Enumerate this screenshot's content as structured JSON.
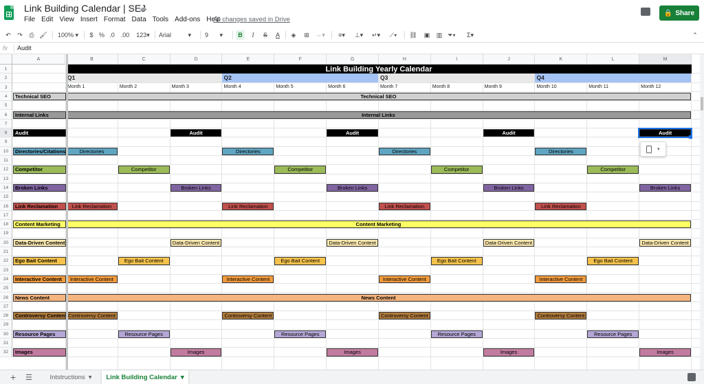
{
  "app": {
    "title": "Link Building Calendar | SEJ",
    "menu": [
      "File",
      "Edit",
      "View",
      "Insert",
      "Format",
      "Data",
      "Tools",
      "Add-ons",
      "Help"
    ],
    "saved_status": "All changes saved in Drive",
    "share_label": "Share"
  },
  "toolbar": {
    "zoom": "100%",
    "currency": "$",
    "percent": "%",
    "decimal_dec": ".0",
    "decimal_inc": ".00",
    "number_format": "123",
    "font": "Arial",
    "font_size": "9",
    "bold": "B",
    "italic": "I",
    "strike": "S",
    "text_color": "A"
  },
  "formula_bar": {
    "fx": "fx",
    "value": "Audit"
  },
  "grid": {
    "columns": [
      "A",
      "B",
      "C",
      "D",
      "E",
      "F",
      "G",
      "H",
      "I",
      "J",
      "K",
      "L",
      "M"
    ],
    "rows": [
      "1",
      "2",
      "3",
      "4",
      "5",
      "6",
      "7",
      "8",
      "9",
      "10",
      "11",
      "12",
      "13",
      "14",
      "15",
      "16",
      "17",
      "18",
      "19",
      "20",
      "21",
      "22",
      "23",
      "24",
      "25",
      "26",
      "27",
      "28",
      "29",
      "30",
      "31",
      "32"
    ],
    "selected_column": "M",
    "selected_row": "8",
    "title": "Link Building Yearly Calendar",
    "quarters": [
      "Q1",
      "Q2",
      "Q3",
      "Q4"
    ],
    "months": [
      "Month 1",
      "Month 2",
      "Month 3",
      "Month 4",
      "Month 5",
      "Month 6",
      "Month 7",
      "Month 8",
      "Month 9",
      "Month 10",
      "Month 11",
      "Month 12"
    ],
    "categories": [
      {
        "row": 4,
        "label": "Technical SEO",
        "color": "#d0d0d0",
        "text_color": "#000000",
        "span": true,
        "span_text": "Technical SEO"
      },
      {
        "row": 6,
        "label": "Internal Links",
        "color": "#999999",
        "text_color": "#000000",
        "span": true,
        "span_text": "Internal Links"
      },
      {
        "row": 8,
        "label": "Audit",
        "color": "#000000",
        "text_color": "#ffffff",
        "bars": [
          {
            "col": 3,
            "text": "Audit"
          },
          {
            "col": 6,
            "text": "Audit"
          },
          {
            "col": 9,
            "text": "Audit"
          },
          {
            "col": 12,
            "text": "Audit"
          }
        ]
      },
      {
        "row": 10,
        "label": "Directories/Citations",
        "color": "#5fa4c0",
        "text_color": "#000000",
        "bars": [
          {
            "col": 1,
            "text": "Directories"
          },
          {
            "col": 4,
            "text": "Directories"
          },
          {
            "col": 7,
            "text": "Directories"
          },
          {
            "col": 10,
            "text": "Directories"
          }
        ]
      },
      {
        "row": 12,
        "label": "Competitor",
        "color": "#9bbb59",
        "text_color": "#000000",
        "bars": [
          {
            "col": 2,
            "text": "Competitor"
          },
          {
            "col": 5,
            "text": "Competitor"
          },
          {
            "col": 8,
            "text": "Competitor"
          },
          {
            "col": 11,
            "text": "Competitor"
          }
        ]
      },
      {
        "row": 14,
        "label": "Broken Links",
        "color": "#8064a2",
        "text_color": "#000000",
        "bars": [
          {
            "col": 3,
            "text": "Broken Links"
          },
          {
            "col": 6,
            "text": "Broken Links"
          },
          {
            "col": 9,
            "text": "Broken Links"
          },
          {
            "col": 12,
            "text": "Broken Links"
          }
        ]
      },
      {
        "row": 16,
        "label": "Link Reclamation",
        "color": "#c0504d",
        "text_color": "#000000",
        "bars": [
          {
            "col": 1,
            "text": "Link Reclamation"
          },
          {
            "col": 4,
            "text": "Link Reclamation"
          },
          {
            "col": 7,
            "text": "Link Reclamation"
          },
          {
            "col": 10,
            "text": "Link Reclamation"
          }
        ]
      },
      {
        "row": 18,
        "label": "Content Marketing",
        "color": "#ffff66",
        "text_color": "#000000",
        "span": true,
        "span_text": "Content Marketing"
      },
      {
        "row": 20,
        "label": "Data-Driven Content",
        "color": "#fde9b0",
        "text_color": "#000000",
        "bars": [
          {
            "col": 3,
            "text": "Data-Driven Content"
          },
          {
            "col": 6,
            "text": "Data-Driven Content"
          },
          {
            "col": 9,
            "text": "Data-Driven Content"
          },
          {
            "col": 12,
            "text": "Data-Driven Content"
          }
        ]
      },
      {
        "row": 22,
        "label": "Ego Bait Content",
        "color": "#f6c24b",
        "text_color": "#000000",
        "bars": [
          {
            "col": 2,
            "text": "Ego Bait Content"
          },
          {
            "col": 5,
            "text": "Ego Bait Content"
          },
          {
            "col": 8,
            "text": "Ego Bait Content"
          },
          {
            "col": 11,
            "text": "Ego Bait Content"
          }
        ]
      },
      {
        "row": 24,
        "label": "Interactive Content",
        "color": "#f39b3c",
        "text_color": "#000000",
        "bars": [
          {
            "col": 1,
            "text": "Interactive Content"
          },
          {
            "col": 4,
            "text": "Interactive Content"
          },
          {
            "col": 7,
            "text": "Interactive Content"
          },
          {
            "col": 10,
            "text": "Interactive Content"
          }
        ]
      },
      {
        "row": 26,
        "label": "News Content",
        "color": "#f5b57e",
        "text_color": "#000000",
        "span": true,
        "span_text": "News Content"
      },
      {
        "row": 28,
        "label": "Controversy Content",
        "color": "#b07a3b",
        "text_color": "#000000",
        "bars": [
          {
            "col": 1,
            "text": "Controversy Content"
          },
          {
            "col": 4,
            "text": "Controversy Content"
          },
          {
            "col": 7,
            "text": "Controversy Content"
          },
          {
            "col": 10,
            "text": "Controversy Content"
          }
        ]
      },
      {
        "row": 30,
        "label": "Resource Pages",
        "color": "#b4a7d6",
        "text_color": "#000000",
        "bars": [
          {
            "col": 2,
            "text": "Resource Pages"
          },
          {
            "col": 5,
            "text": "Resource Pages"
          },
          {
            "col": 8,
            "text": "Resource Pages"
          },
          {
            "col": 11,
            "text": "Resource Pages"
          }
        ]
      },
      {
        "row": 32,
        "label": "Images",
        "color": "#c27ba0",
        "text_color": "#000000",
        "bars": [
          {
            "col": 3,
            "text": "Images"
          },
          {
            "col": 6,
            "text": "Images"
          },
          {
            "col": 9,
            "text": "Images"
          },
          {
            "col": 12,
            "text": "Images"
          }
        ]
      }
    ],
    "colors": {
      "quarter_q1": "#e8e8e8",
      "quarter_q2": "#a4c2f4",
      "quarter_q3": "#e8e8e8",
      "quarter_q4": "#a4c2f4",
      "selection": "#1a73e8",
      "title_bg": "#000000"
    }
  },
  "sheets": [
    {
      "name": "Intstructions",
      "active": false
    },
    {
      "name": "Link Building Calendar",
      "active": true
    }
  ]
}
